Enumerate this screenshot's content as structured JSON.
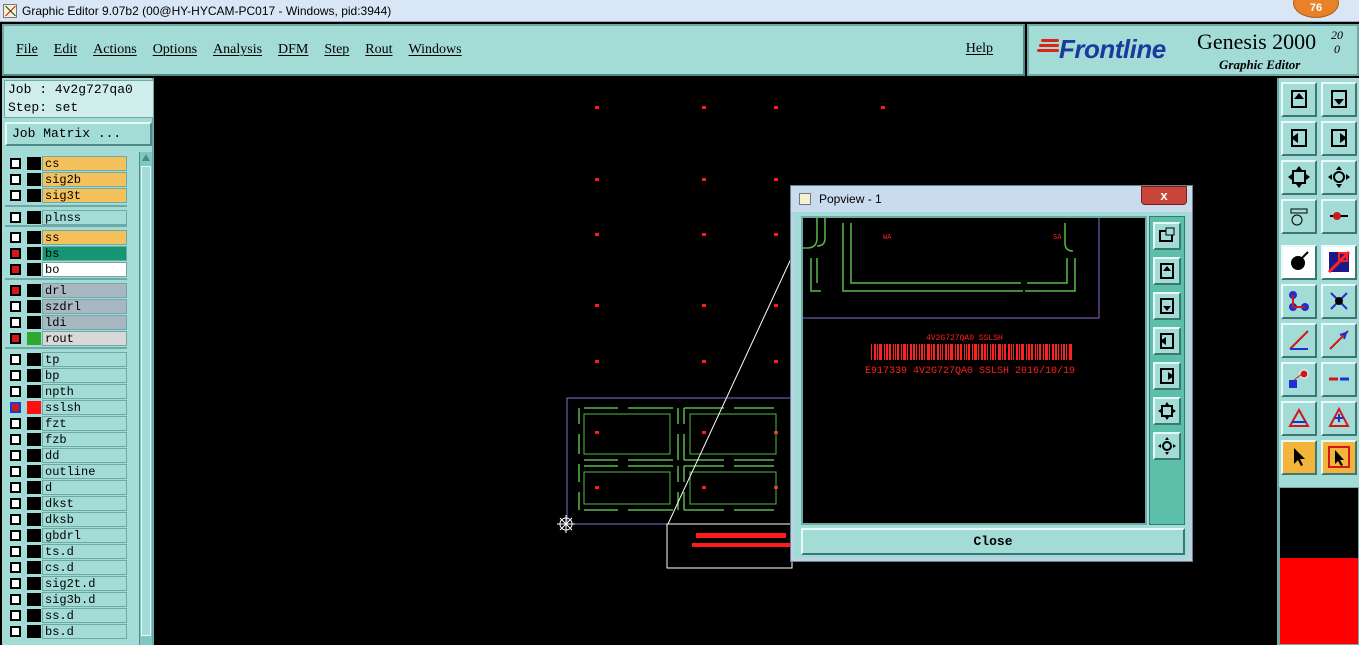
{
  "window": {
    "title": "Graphic Editor 9.07b2 (00@HY-HYCAM-PC017 - Windows, pid:3944)",
    "badge": "76"
  },
  "menu": {
    "items": [
      "File",
      "Edit",
      "Actions",
      "Options",
      "Analysis",
      "DFM",
      "Step",
      "Rout",
      "Windows"
    ],
    "help": "Help"
  },
  "brand": {
    "logo": "Frontline",
    "product": "Genesis 2000",
    "version_top": "2",
    "version_bottom": "0",
    "version_mid": "0",
    "subtitle": "Graphic Editor"
  },
  "job": {
    "job_label": "Job : 4v2g727qa0",
    "step_label": "Step: set",
    "matrix_button": "Job Matrix ..."
  },
  "layers": [
    {
      "name": "cs",
      "bg": "#f5c15a",
      "checked": false
    },
    {
      "name": "sig2b",
      "bg": "#f5c15a",
      "checked": false
    },
    {
      "name": "sig3t",
      "bg": "#f5c15a",
      "checked": false
    },
    {
      "name": "plnss",
      "bg": "#a3dbd7",
      "checked": false
    },
    {
      "name": "ss",
      "bg": "#f5c15a",
      "checked": false
    },
    {
      "name": "bs",
      "bg": "#159673",
      "checked": true
    },
    {
      "name": "bo",
      "bg": "#ffffff",
      "checked": true
    },
    {
      "name": "drl",
      "bg": "#a8b7c1",
      "checked": true
    },
    {
      "name": "szdrl",
      "bg": "#a8b7c1",
      "checked": false
    },
    {
      "name": "ldi",
      "bg": "#a8b7c1",
      "checked": false
    },
    {
      "name": "rout",
      "bg": "#d8d8d8",
      "checked": true,
      "swatch": "#2fa82f"
    },
    {
      "name": "tp",
      "bg": "#a3dbd7",
      "checked": false
    },
    {
      "name": "bp",
      "bg": "#a3dbd7",
      "checked": false
    },
    {
      "name": "npth",
      "bg": "#a3dbd7",
      "checked": false
    },
    {
      "name": "sslsh",
      "bg": "#a3dbd7",
      "checked": true,
      "swatch": "#ff1010",
      "active": true
    },
    {
      "name": "fzt",
      "bg": "#a3dbd7",
      "checked": false
    },
    {
      "name": "fzb",
      "bg": "#a3dbd7",
      "checked": false
    },
    {
      "name": "dd",
      "bg": "#a3dbd7",
      "checked": false
    },
    {
      "name": "outline",
      "bg": "#a3dbd7",
      "checked": false
    },
    {
      "name": "d",
      "bg": "#a3dbd7",
      "checked": false
    },
    {
      "name": "dkst",
      "bg": "#a3dbd7",
      "checked": false
    },
    {
      "name": "dksb",
      "bg": "#a3dbd7",
      "checked": false
    },
    {
      "name": "gbdrl",
      "bg": "#a3dbd7",
      "checked": false
    },
    {
      "name": "ts.d",
      "bg": "#a3dbd7",
      "checked": false
    },
    {
      "name": "cs.d",
      "bg": "#a3dbd7",
      "checked": false
    },
    {
      "name": "sig2t.d",
      "bg": "#a3dbd7",
      "checked": false
    },
    {
      "name": "sig3b.d",
      "bg": "#a3dbd7",
      "checked": false
    },
    {
      "name": "ss.d",
      "bg": "#a3dbd7",
      "checked": false
    },
    {
      "name": "bs.d",
      "bg": "#a3dbd7",
      "checked": false
    }
  ],
  "popview": {
    "title": "Popview - 1",
    "close_x": "x",
    "barcode_top": "4V2G727QA0 SSLSH",
    "barcode_bottom": "E917339 4V2G727QA0 SSLSH 2016/10/19",
    "corner_left": "WA",
    "corner_right": "SA",
    "close_label": "Close"
  },
  "colors": {
    "panel": "#a3dbd7",
    "canvas": "#000000",
    "route": "#59b84a",
    "profile": "#8e6ad0",
    "feature_red": "#ff1a1a"
  }
}
